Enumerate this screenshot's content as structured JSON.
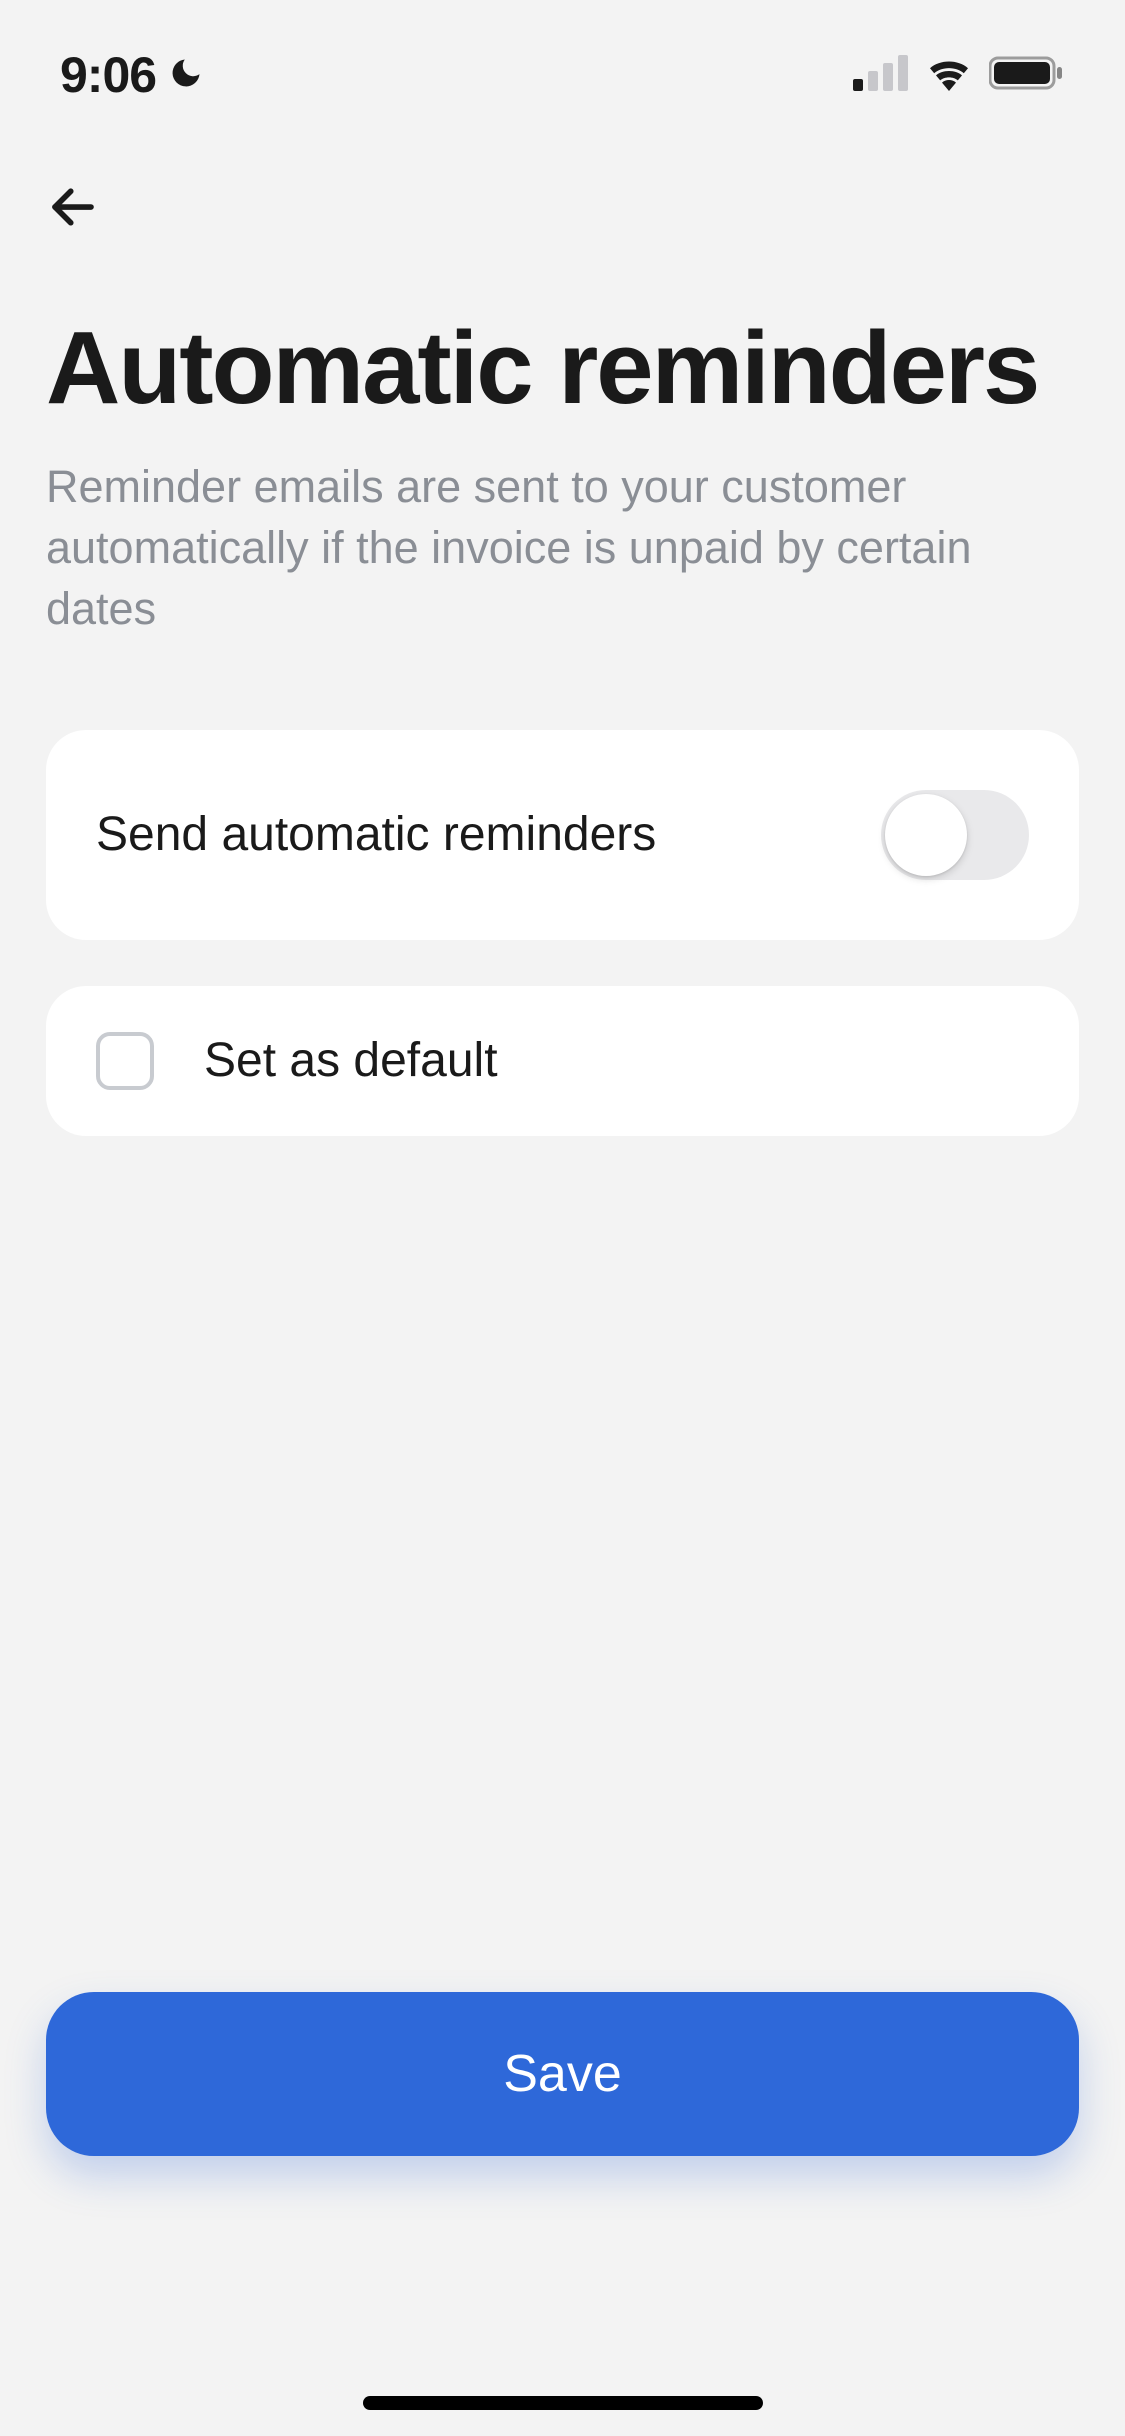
{
  "status": {
    "time": "9:06"
  },
  "nav": {
    "back": "Back"
  },
  "page": {
    "title": "Automatic reminders",
    "subtitle": "Reminder emails are sent to your customer automatically if the invoice is unpaid by certain dates"
  },
  "settings": {
    "reminder_toggle_label": "Send automatic reminders",
    "reminder_toggle_on": false,
    "default_checkbox_label": "Set as default",
    "default_checked": false
  },
  "actions": {
    "save_label": "Save"
  }
}
